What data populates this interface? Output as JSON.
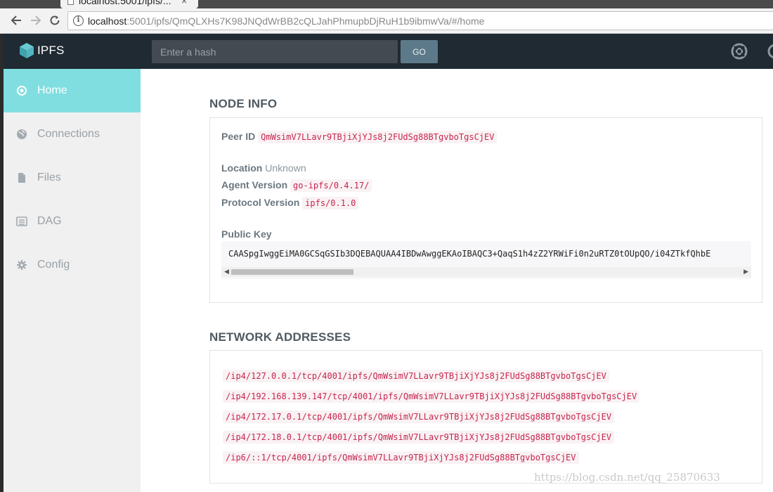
{
  "browser": {
    "tab_title": "localhost:5001/ipfs/...",
    "tab_close": "×",
    "url_host": "localhost",
    "url_rest": ":5001/ipfs/QmQLXHs7K98JNQdWrBB2cQLJahPhmupbDjRuH1b9ibmwVa/#/home",
    "back_icon": "arrow-left",
    "forward_icon": "arrow-right",
    "reload_icon": "reload",
    "info_icon": "info-circle"
  },
  "header": {
    "logo_text": "IPFS",
    "search_placeholder": "Enter a hash",
    "search_value": "",
    "go_label": "GO",
    "icons": [
      "lifebuoy-icon",
      "settings-icon"
    ]
  },
  "sidebar": {
    "items": [
      {
        "label": "Home",
        "icon": "circle-dot-icon",
        "active": true
      },
      {
        "label": "Connections",
        "icon": "globe-icon",
        "active": false
      },
      {
        "label": "Files",
        "icon": "file-icon",
        "active": false
      },
      {
        "label": "DAG",
        "icon": "list-icon",
        "active": false
      },
      {
        "label": "Config",
        "icon": "gear-icon",
        "active": false
      }
    ]
  },
  "node_info": {
    "title": "NODE INFO",
    "peer_id_label": "Peer ID",
    "peer_id": "QmWsimV7LLavr9TBjiXjYJs8j2FUdSg88BTgvboTgsCjEV",
    "location_label": "Location",
    "location": "Unknown",
    "agent_label": "Agent Version",
    "agent": "go-ipfs/0.4.17/",
    "protocol_label": "Protocol Version",
    "protocol": "ipfs/0.1.0",
    "pubkey_label": "Public Key",
    "pubkey": "CAASpgIwggEiMA0GCSqGSIb3DQEBAQUAA4IBDwAwggEKAoIBAQC3+QaqS1h4zZ2YRWiFi0n2uRTZ0tOUpQO/i04ZTkfQhbE"
  },
  "network": {
    "title": "NETWORK ADDRESSES",
    "addresses": [
      "/ip4/127.0.0.1/tcp/4001/ipfs/QmWsimV7LLavr9TBjiXjYJs8j2FUdSg88BTgvboTgsCjEV",
      "/ip4/192.168.139.147/tcp/4001/ipfs/QmWsimV7LLavr9TBjiXjYJs8j2FUdSg88BTgvboTgsCjEV",
      "/ip4/172.17.0.1/tcp/4001/ipfs/QmWsimV7LLavr9TBjiXjYJs8j2FUdSg88BTgvboTgsCjEV",
      "/ip4/172.18.0.1/tcp/4001/ipfs/QmWsimV7LLavr9TBjiXjYJs8j2FUdSg88BTgvboTgsCjEV",
      "/ip6/::1/tcp/4001/ipfs/QmWsimV7LLavr9TBjiXjYJs8j2FUdSg88BTgvboTgsCjEV"
    ]
  },
  "watermark": "https://blog.csdn.net/qq_25870633",
  "colors": {
    "header_bg": "#1f2a33",
    "sidebar_active": "#80dee0",
    "code_red": "#c7254e",
    "go_button": "#5d7a8a"
  }
}
